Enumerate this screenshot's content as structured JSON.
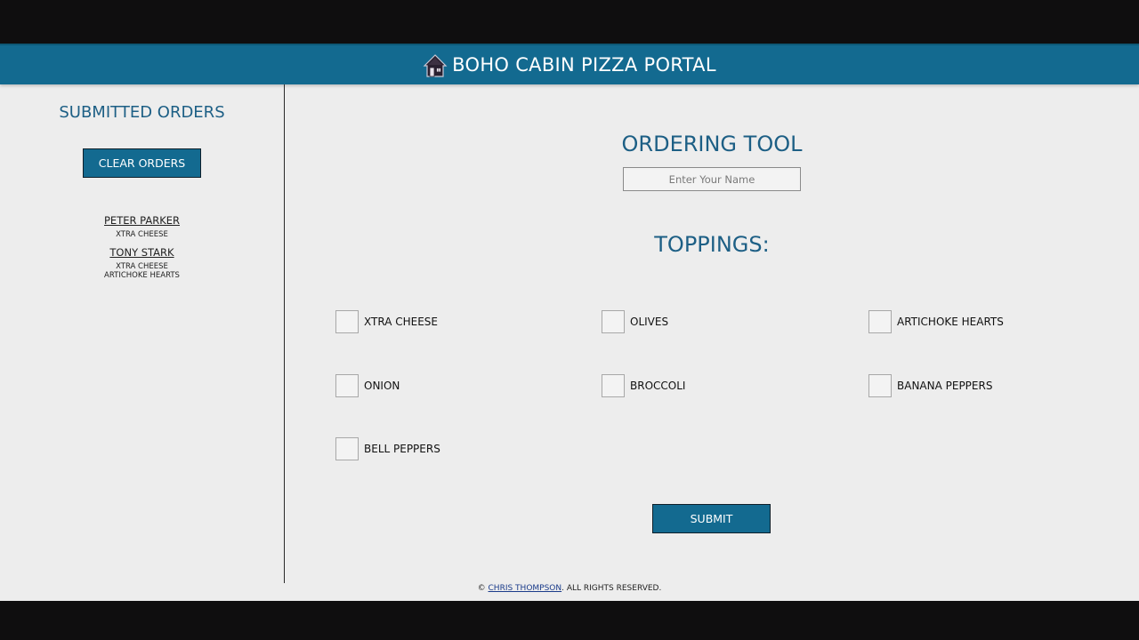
{
  "header": {
    "title": "BOHO CABIN  PIZZA  PORTAL",
    "logo_icon": "cabin-logo-icon"
  },
  "sidebar": {
    "title": "SUBMITTED ORDERS",
    "clear_label": "CLEAR ORDERS",
    "orders": [
      {
        "name": "PETER  PARKER",
        "toppings": [
          "XTRA CHEESE"
        ]
      },
      {
        "name": "TONY STARK",
        "toppings": [
          "XTRA CHEESE",
          "ARTICHOKE  HEARTS"
        ]
      }
    ]
  },
  "main": {
    "title": "ORDERING TOOL",
    "name_placeholder": "Enter Your Name",
    "name_value": "",
    "toppings_title": "TOPPINGS:",
    "toppings": [
      {
        "label": "XTRA CHEESE",
        "checked": false
      },
      {
        "label": "OLIVES",
        "checked": false
      },
      {
        "label": "ARTICHOKE  HEARTS",
        "checked": false
      },
      {
        "label": "ONION",
        "checked": false
      },
      {
        "label": "BROCCOLI",
        "checked": false
      },
      {
        "label": "BANANA  PEPPERS",
        "checked": false
      },
      {
        "label": "BELL  PEPPERS",
        "checked": false
      }
    ],
    "submit_label": "SUBMIT"
  },
  "footer": {
    "prefix": "© ",
    "author": "CHRIS THOMPSON",
    "suffix": ". ALL  RIGHTS  RESERVED."
  },
  "colors": {
    "accent": "#136a90",
    "heading": "#1d5f85",
    "background": "#ededed"
  }
}
